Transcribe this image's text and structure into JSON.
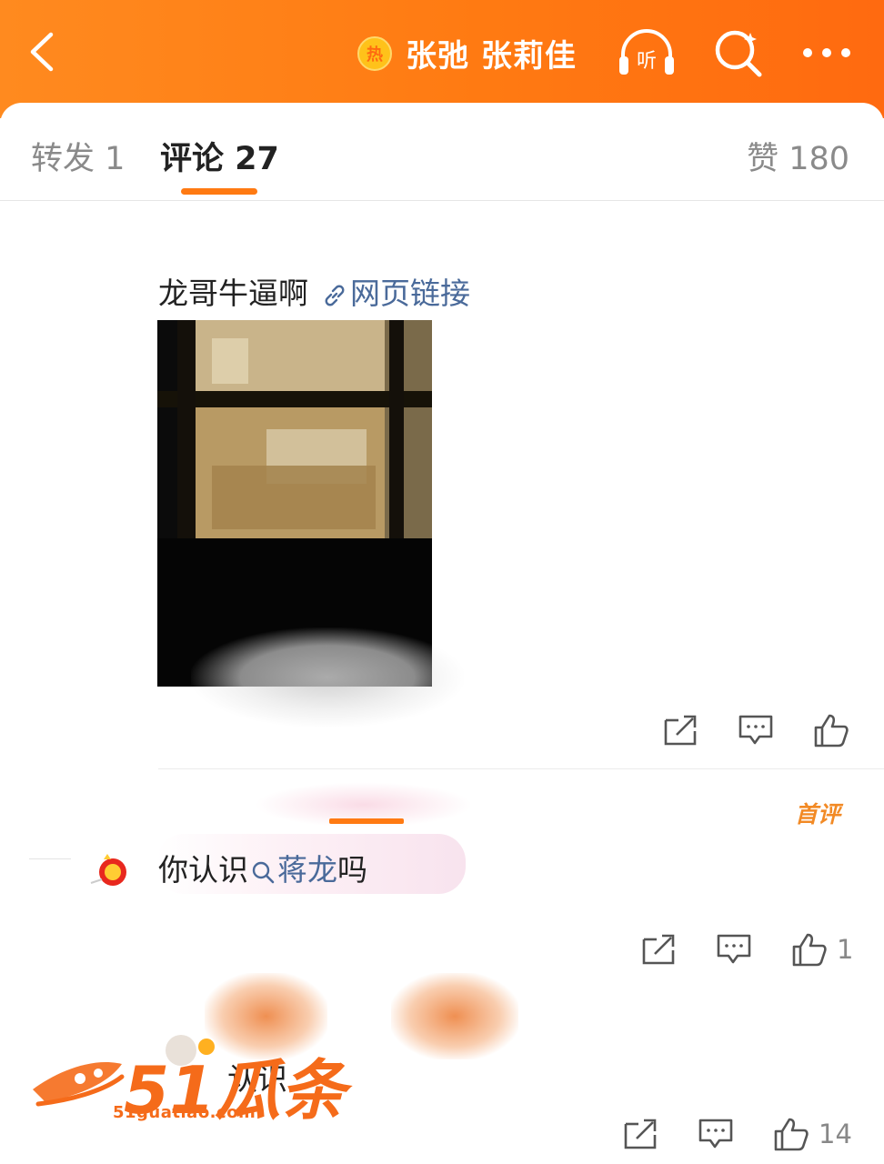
{
  "header": {
    "hot_badge": "热",
    "topic": "张弛 张莉佳",
    "listen_label": "听",
    "icons": [
      "back-arrow-icon",
      "headphones-icon",
      "search-icon",
      "more-icon"
    ],
    "accent": "#ff7a12"
  },
  "tabs": {
    "repost": "转发 1",
    "comment": "评论 27",
    "like": "赞 180"
  },
  "comments": [
    {
      "text": "龙哥牛逼啊",
      "link": "网页链接",
      "counts": {
        "like": ""
      }
    },
    {
      "badge": "首评",
      "text_before": "你认识",
      "topic": "蒋龙",
      "text_after": "吗",
      "counts": {
        "like": "1"
      }
    },
    {
      "text": "认识",
      "counts": {
        "like": "14"
      }
    }
  ],
  "watermark": {
    "brand": "51瓜条",
    "url": "51guatiao.com"
  }
}
